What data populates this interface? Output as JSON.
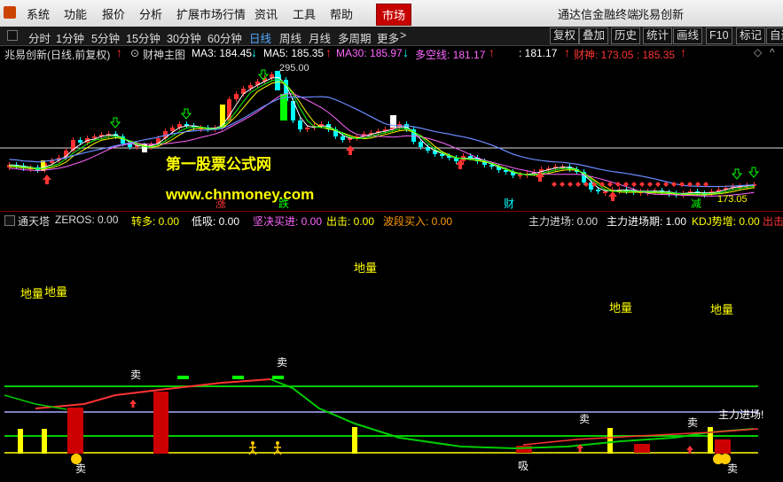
{
  "menu": {
    "items": [
      "系统",
      "功能",
      "报价",
      "分析",
      "扩展市场行情",
      "资讯",
      "工具",
      "帮助"
    ],
    "active": "市场",
    "app_name": "通达信金融终端",
    "account": "兆易创新"
  },
  "periods": {
    "items": [
      "分时",
      "1分钟",
      "5分钟",
      "15分钟",
      "30分钟",
      "60分钟",
      "日线",
      "周线",
      "月线",
      "多周期",
      "更多"
    ],
    "selected": "日线",
    "more_arrow": ">",
    "tools": [
      "复权",
      "叠加",
      "历史",
      "统计",
      "画线",
      "F10",
      "标记",
      "自选"
    ]
  },
  "main_panel": {
    "title": "兆易创新(日线,前复权)",
    "indicator": "财神主图",
    "ma3": "MA3: 184.45",
    "ma5": "MA5: 185.35",
    "ma30": "MA30: 185.97",
    "duokong": "多空线: 181.17",
    "val1": ": 181.17",
    "caishen": "财神: 173.05 : 185.35",
    "peak_label": "295.00",
    "low_label": "173.05",
    "watermark1": "第一股票公式网",
    "watermark2": "www.chnmoney.com",
    "marker_zhang": "涨",
    "marker_die": "跌",
    "marker_cai": "财",
    "marker_jian": "减",
    "colors": {
      "up": "#ff3030",
      "down": "#00ffff",
      "ma_white": "#ffffff",
      "ma_yellow": "#ffff00",
      "ma_purple": "#ff66ff",
      "ma_green": "#00ff00",
      "ma_blue": "#6a8cff"
    }
  },
  "sub_panel": {
    "title": "通天塔",
    "zeros": "ZEROS: 0.00",
    "zhuanduo": "转多: 0.00",
    "dixi": "低吸: 0.00",
    "jianjue": "坚决买进: 0.00",
    "chuji": "出击: 0.00",
    "boduan": "波段买入: 0.00",
    "zhuli": "主力进场: 0.00",
    "zhuliqi": "主力进场期: 1.00",
    "kdj": "KDJ势增: 0.00",
    "chu": "出击",
    "diliang": "地量",
    "mai": "卖",
    "xi": "吸",
    "zhuli_label": "主力进场!"
  }
}
